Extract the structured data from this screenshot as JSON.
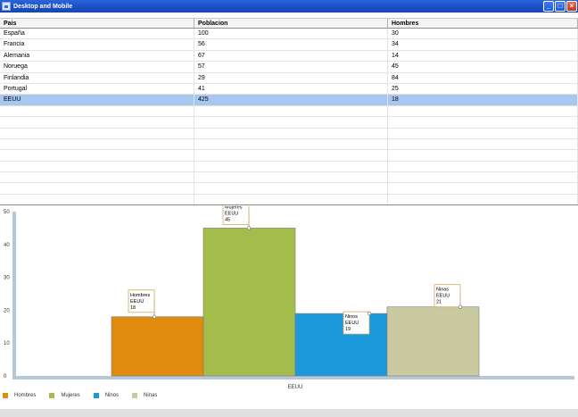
{
  "window": {
    "title": "Desktop and Mobile"
  },
  "table": {
    "headers": [
      "Pais",
      "Poblacion",
      "Hombres"
    ],
    "rows": [
      [
        "España",
        "100",
        "30"
      ],
      [
        "Francia",
        "56",
        "34"
      ],
      [
        "Alemania",
        "67",
        "14"
      ],
      [
        "Noruega",
        "57",
        "45"
      ],
      [
        "Finlandia",
        "29",
        "84"
      ],
      [
        "Portugal",
        "41",
        "25"
      ],
      [
        "EEUU",
        "425",
        "18"
      ]
    ],
    "selected_row": 6
  },
  "chart_data": {
    "type": "bar",
    "categories": [
      "EEUU"
    ],
    "series": [
      {
        "name": "Hombres",
        "values": [
          18
        ],
        "color": "#e08a0e"
      },
      {
        "name": "Mujeres",
        "values": [
          45
        ],
        "color": "#a4bc4c"
      },
      {
        "name": "Ninos",
        "values": [
          19
        ],
        "color": "#1c98dc"
      },
      {
        "name": "Ninas",
        "values": [
          21
        ],
        "color": "#cacaa0"
      }
    ],
    "ylim": [
      0,
      50
    ],
    "yticks": [
      0,
      10,
      20,
      30,
      40,
      50
    ],
    "xlabel": "",
    "ylabel": "",
    "grid": false,
    "legend": "bottom-left",
    "tooltips": [
      {
        "series": "Hombres",
        "lines": [
          "Hombres",
          "EEUU",
          "18"
        ]
      },
      {
        "series": "Mujeres",
        "lines": [
          "Mujeres",
          "EEUU",
          "45"
        ]
      },
      {
        "series": "Ninos",
        "lines": [
          "Ninos",
          "EEUU",
          "19"
        ]
      },
      {
        "series": "Ninas",
        "lines": [
          "Ninas",
          "EEUU",
          "21"
        ]
      }
    ]
  }
}
